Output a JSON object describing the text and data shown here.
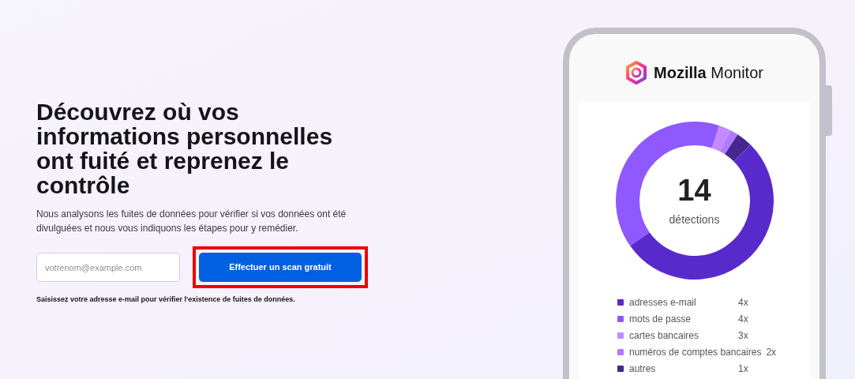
{
  "hero": {
    "heading": "Découvrez où vos informations personnelles ont fuité et reprenez le contrôle",
    "description": "Nous analysons les fuites de données pour vérifier si vos données ont été divulguées et nous vous indiquons les étapes pour y remédier.",
    "email_field": {
      "placeholder": "votrenom@example.com"
    },
    "scan_button": {
      "label": "Effectuer un scan gratuit",
      "highlighted": true
    },
    "hint": "Saisissez votre adresse e-mail pour vérifier l'existence de fuites de données."
  },
  "phone": {
    "brand": {
      "bold": "Mozilla",
      "light": "Monitor"
    },
    "summary": {
      "count": "14",
      "label": "détections"
    },
    "legend": [
      {
        "label": "adresses e-mail",
        "count": "4x",
        "color": "#592acb"
      },
      {
        "label": "mots de passe",
        "count": "4x",
        "color": "#9059ff"
      },
      {
        "label": "cartes bancaires",
        "count": "3x",
        "color": "#c689ff"
      },
      {
        "label": "numéros de comptes bancaires",
        "count": "2x",
        "color": "#b07bff"
      },
      {
        "label": "autres",
        "count": "1x",
        "color": "#45278d"
      }
    ]
  }
}
